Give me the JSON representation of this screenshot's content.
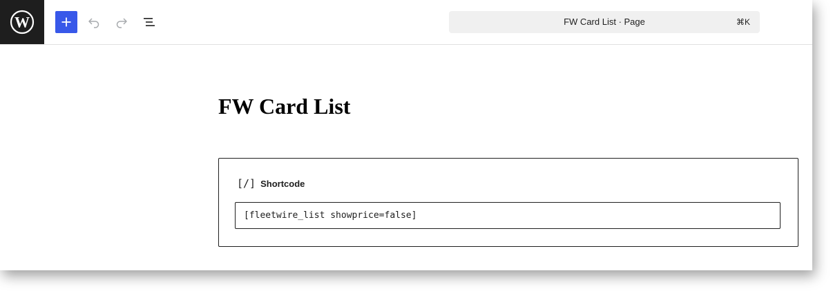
{
  "topbar": {
    "logo_icon": "wordpress-icon",
    "add_icon": "plus-icon",
    "undo_icon": "undo-icon",
    "redo_icon": "redo-icon",
    "list_view_icon": "list-view-icon",
    "command_bar": {
      "title": "FW Card List · Page",
      "shortcut": "⌘K"
    }
  },
  "page": {
    "title": "FW Card List"
  },
  "shortcode_block": {
    "icon": "[/]",
    "label": "Shortcode",
    "value": "[fleetwire_list showprice=false]"
  },
  "colors": {
    "accent": "#3858e9",
    "logo_bg": "#1e1e1e",
    "command_bar_bg": "#f0f0f0"
  }
}
